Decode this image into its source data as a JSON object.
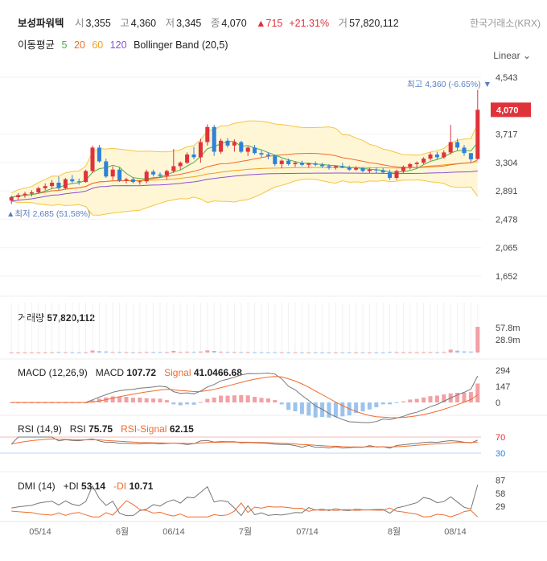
{
  "header": {
    "stock_name": "보성파워텍",
    "open_label": "시",
    "open": "3,355",
    "high_label": "고",
    "high": "4,360",
    "low_label": "저",
    "low": "3,345",
    "close_label": "종",
    "close": "4,070",
    "change": "▲715",
    "change_pct": "+21.31%",
    "volume_label": "거",
    "volume": "57,820,112",
    "exchange": "한국거래소(KRX)"
  },
  "indicators": {
    "ma_label": "이동평균",
    "ma5": "5",
    "ma20": "20",
    "ma60": "60",
    "ma120": "120",
    "bollinger": "Bollinger Band (20,5)",
    "scale_mode": "Linear"
  },
  "colors": {
    "up": "#e0323a",
    "down": "#2f80d9",
    "ma5": "#4caf50",
    "ma20": "#ef6c2e",
    "ma60": "#f0a020",
    "ma120": "#8a4fd8",
    "band": "#f5c542",
    "band_fill": "#fff6d6",
    "current_price": "#e0323a",
    "accent": "#5b7fc4"
  },
  "chart_data": [
    {
      "type": "candlestick",
      "title": "Price",
      "y_ticks": [
        "4,543",
        "3,717",
        "3,304",
        "2,891",
        "2,478",
        "2,065",
        "1,652"
      ],
      "ylim": [
        1652,
        4543
      ],
      "current_price": "4,070",
      "annotations": {
        "high": "최고 4,360 (-6.65%)",
        "low": "최저 2,685 (51.58%)"
      },
      "x_labels": [
        "05/14",
        "6월",
        "06/14",
        "7월",
        "07/14",
        "8월",
        "08/14"
      ],
      "candles": [
        [
          2750,
          2820,
          2700,
          2800
        ],
        [
          2800,
          2860,
          2760,
          2830
        ],
        [
          2830,
          2880,
          2790,
          2850
        ],
        [
          2850,
          2900,
          2810,
          2870
        ],
        [
          2870,
          2950,
          2850,
          2930
        ],
        [
          2930,
          3000,
          2900,
          2960
        ],
        [
          2960,
          3050,
          2920,
          3010
        ],
        [
          3010,
          3100,
          2900,
          2930
        ],
        [
          2930,
          3080,
          2910,
          3060
        ],
        [
          3060,
          3120,
          3000,
          3030
        ],
        [
          3030,
          3070,
          2980,
          3020
        ],
        [
          3020,
          3200,
          3010,
          3180
        ],
        [
          3180,
          3550,
          3150,
          3520
        ],
        [
          3520,
          3560,
          3300,
          3320
        ],
        [
          3320,
          3360,
          3080,
          3100
        ],
        [
          3100,
          3250,
          3050,
          3200
        ],
        [
          3200,
          3230,
          3020,
          3040
        ],
        [
          3040,
          3080,
          3000,
          3060
        ],
        [
          3060,
          3090,
          3000,
          3020
        ],
        [
          3020,
          3050,
          2980,
          3030
        ],
        [
          3030,
          3200,
          3000,
          3170
        ],
        [
          3170,
          3200,
          3100,
          3130
        ],
        [
          3130,
          3160,
          3080,
          3110
        ],
        [
          3110,
          3200,
          3050,
          3180
        ],
        [
          3180,
          3500,
          3150,
          3250
        ],
        [
          3250,
          3320,
          3200,
          3300
        ],
        [
          3300,
          3450,
          3280,
          3420
        ],
        [
          3420,
          3530,
          3350,
          3380
        ],
        [
          3380,
          3650,
          3300,
          3600
        ],
        [
          3600,
          3860,
          3550,
          3820
        ],
        [
          3820,
          3850,
          3400,
          3460
        ],
        [
          3460,
          3650,
          3430,
          3620
        ],
        [
          3620,
          3660,
          3520,
          3550
        ],
        [
          3550,
          3640,
          3460,
          3600
        ],
        [
          3600,
          3620,
          3440,
          3460
        ],
        [
          3460,
          3540,
          3400,
          3520
        ],
        [
          3520,
          3560,
          3420,
          3440
        ],
        [
          3440,
          3480,
          3380,
          3420
        ],
        [
          3420,
          3450,
          3350,
          3400
        ],
        [
          3400,
          3420,
          3250,
          3280
        ],
        [
          3280,
          3350,
          3220,
          3330
        ],
        [
          3330,
          3360,
          3260,
          3280
        ],
        [
          3280,
          3320,
          3240,
          3300
        ],
        [
          3300,
          3330,
          3250,
          3270
        ],
        [
          3270,
          3300,
          3230,
          3290
        ],
        [
          3290,
          3320,
          3250,
          3270
        ],
        [
          3270,
          3300,
          3230,
          3250
        ],
        [
          3250,
          3280,
          3200,
          3230
        ],
        [
          3230,
          3260,
          3200,
          3250
        ],
        [
          3250,
          3300,
          3220,
          3230
        ],
        [
          3230,
          3260,
          3180,
          3200
        ],
        [
          3200,
          3250,
          3180,
          3220
        ],
        [
          3220,
          3240,
          3160,
          3180
        ],
        [
          3180,
          3230,
          3150,
          3200
        ],
        [
          3200,
          3230,
          3150,
          3190
        ],
        [
          3190,
          3220,
          3140,
          3160
        ],
        [
          3160,
          3200,
          3050,
          3080
        ],
        [
          3080,
          3200,
          3050,
          3180
        ],
        [
          3180,
          3260,
          3150,
          3240
        ],
        [
          3240,
          3300,
          3200,
          3280
        ],
        [
          3280,
          3320,
          3230,
          3300
        ],
        [
          3300,
          3380,
          3280,
          3360
        ],
        [
          3360,
          3450,
          3330,
          3420
        ],
        [
          3420,
          3460,
          3350,
          3380
        ],
        [
          3380,
          3480,
          3360,
          3450
        ],
        [
          3450,
          3850,
          3420,
          3600
        ],
        [
          3600,
          3650,
          3480,
          3520
        ],
        [
          3520,
          3560,
          3400,
          3440
        ],
        [
          3440,
          3420,
          3300,
          3350
        ],
        [
          3355,
          4360,
          3345,
          4070
        ]
      ]
    },
    {
      "type": "bar",
      "title": "거래량",
      "label_value": "57,820,112",
      "y_ticks": [
        "57.8m",
        "28.9m"
      ],
      "values": [
        0.3,
        0.2,
        0.4,
        0.3,
        0.5,
        0.6,
        0.8,
        1.2,
        0.9,
        0.7,
        0.5,
        0.8,
        4.5,
        3.1,
        2.4,
        1.6,
        1.2,
        0.8,
        0.6,
        0.7,
        1.5,
        1.1,
        0.9,
        1.0,
        3.8,
        1.5,
        1.9,
        1.6,
        2.2,
        4.8,
        3.6,
        2.0,
        1.4,
        1.2,
        1.1,
        0.9,
        0.8,
        0.7,
        0.6,
        0.9,
        0.7,
        0.5,
        0.6,
        0.5,
        0.4,
        0.5,
        0.4,
        0.5,
        0.4,
        0.4,
        0.5,
        0.4,
        0.4,
        0.5,
        0.4,
        0.5,
        1.6,
        1.1,
        0.9,
        0.8,
        0.7,
        0.9,
        1.0,
        0.8,
        1.2,
        6.5,
        4.2,
        2.6,
        2.2,
        57.8
      ]
    },
    {
      "type": "line",
      "title": "MACD (12,26,9)",
      "macd_label": "MACD",
      "macd_value": "107.72",
      "signal_label": "Signal",
      "signal_value": "41.0466.68",
      "y_ticks": [
        "294",
        "147",
        "0"
      ],
      "ylim": [
        -40,
        300
      ]
    },
    {
      "type": "line",
      "title": "RSI (14,9)",
      "rsi_label": "RSI",
      "rsi_value": "75.75",
      "signal_label": "RSI-Signal",
      "signal_value": "62.15",
      "y_ticks": [
        "70",
        "30"
      ],
      "ylim": [
        0,
        100
      ]
    },
    {
      "type": "line",
      "title": "DMI (14)",
      "pdi_label": "+DI",
      "pdi_value": "53.14",
      "mdi_label": "-DI",
      "mdi_value": "10.71",
      "y_ticks": [
        "87",
        "58",
        "29"
      ],
      "ylim": [
        0,
        90
      ]
    }
  ]
}
